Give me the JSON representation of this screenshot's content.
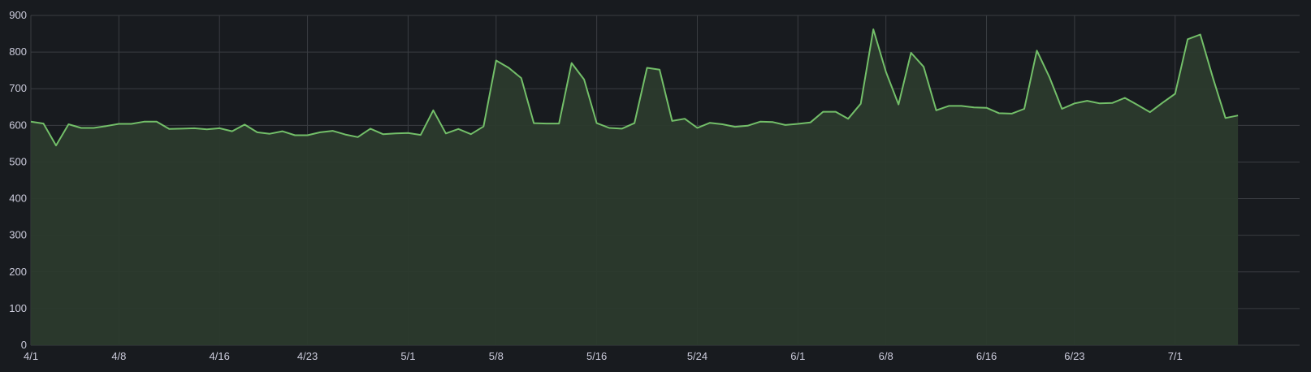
{
  "chart_data": {
    "type": "area",
    "title": "",
    "xlabel": "",
    "ylabel": "",
    "ylim": [
      0,
      900
    ],
    "y_ticks": [
      0,
      100,
      200,
      300,
      400,
      500,
      600,
      700,
      800,
      900
    ],
    "x_ticks": [
      {
        "label": "4/1",
        "date": "2024-04-01"
      },
      {
        "label": "4/8",
        "date": "2024-04-08"
      },
      {
        "label": "4/16",
        "date": "2024-04-16"
      },
      {
        "label": "4/23",
        "date": "2024-04-23"
      },
      {
        "label": "5/1",
        "date": "2024-05-01"
      },
      {
        "label": "5/8",
        "date": "2024-05-08"
      },
      {
        "label": "5/16",
        "date": "2024-05-16"
      },
      {
        "label": "5/24",
        "date": "2024-05-24"
      },
      {
        "label": "6/1",
        "date": "2024-06-01"
      },
      {
        "label": "6/8",
        "date": "2024-06-08"
      },
      {
        "label": "6/16",
        "date": "2024-06-16"
      },
      {
        "label": "6/23",
        "date": "2024-06-23"
      },
      {
        "label": "7/1",
        "date": "2024-07-01"
      }
    ],
    "grid": true,
    "legend": "none",
    "colors": {
      "background": "#181b1f",
      "line": "#73bf69",
      "fill": "#2b3a2d",
      "grid": "#3a3d42",
      "tick_text": "#ccccdc"
    },
    "series": [
      {
        "x": [
          "2024-04-01",
          "2024-04-02",
          "2024-04-03",
          "2024-04-04",
          "2024-04-05",
          "2024-04-06",
          "2024-04-07",
          "2024-04-08",
          "2024-04-09",
          "2024-04-10",
          "2024-04-11",
          "2024-04-12",
          "2024-04-13",
          "2024-04-14",
          "2024-04-15",
          "2024-04-16",
          "2024-04-17",
          "2024-04-18",
          "2024-04-19",
          "2024-04-20",
          "2024-04-21",
          "2024-04-22",
          "2024-04-23",
          "2024-04-24",
          "2024-04-25",
          "2024-04-26",
          "2024-04-27",
          "2024-04-28",
          "2024-04-29",
          "2024-04-30",
          "2024-05-01",
          "2024-05-02",
          "2024-05-03",
          "2024-05-04",
          "2024-05-05",
          "2024-05-06",
          "2024-05-07",
          "2024-05-08",
          "2024-05-09",
          "2024-05-10",
          "2024-05-11",
          "2024-05-12",
          "2024-05-13",
          "2024-05-14",
          "2024-05-15",
          "2024-05-16",
          "2024-05-17",
          "2024-05-18",
          "2024-05-19",
          "2024-05-20",
          "2024-05-21",
          "2024-05-22",
          "2024-05-23",
          "2024-05-24",
          "2024-05-25",
          "2024-05-26",
          "2024-05-27",
          "2024-05-28",
          "2024-05-29",
          "2024-05-30",
          "2024-05-31",
          "2024-06-01",
          "2024-06-02",
          "2024-06-03",
          "2024-06-04",
          "2024-06-05",
          "2024-06-06",
          "2024-06-07",
          "2024-06-08",
          "2024-06-09",
          "2024-06-10",
          "2024-06-11",
          "2024-06-12",
          "2024-06-13",
          "2024-06-14",
          "2024-06-15",
          "2024-06-16",
          "2024-06-17",
          "2024-06-18",
          "2024-06-19",
          "2024-06-20",
          "2024-06-21",
          "2024-06-22",
          "2024-06-23",
          "2024-06-24",
          "2024-06-25",
          "2024-06-26",
          "2024-06-27",
          "2024-06-28",
          "2024-06-29",
          "2024-06-30",
          "2024-07-01",
          "2024-07-02",
          "2024-07-03",
          "2024-07-04",
          "2024-07-05",
          "2024-07-06"
        ],
        "values": [
          610,
          605,
          545,
          603,
          593,
          593,
          598,
          604,
          604,
          610,
          610,
          590,
          591,
          592,
          589,
          592,
          584,
          602,
          581,
          577,
          584,
          573,
          573,
          581,
          585,
          575,
          568,
          591,
          576,
          578,
          579,
          574,
          641,
          578,
          590,
          576,
          597,
          777,
          757,
          729,
          606,
          605,
          605,
          770,
          725,
          606,
          593,
          591,
          606,
          757,
          752,
          612,
          618,
          593,
          607,
          603,
          596,
          599,
          610,
          609,
          601,
          604,
          608,
          637,
          637,
          618,
          659,
          862,
          746,
          657,
          798,
          760,
          641,
          653,
          653,
          649,
          648,
          633,
          632,
          645,
          804,
          732,
          645,
          660,
          667,
          660,
          661,
          675,
          656,
          636,
          662,
          686,
          835,
          848,
          730,
          620,
          627
        ]
      }
    ]
  }
}
